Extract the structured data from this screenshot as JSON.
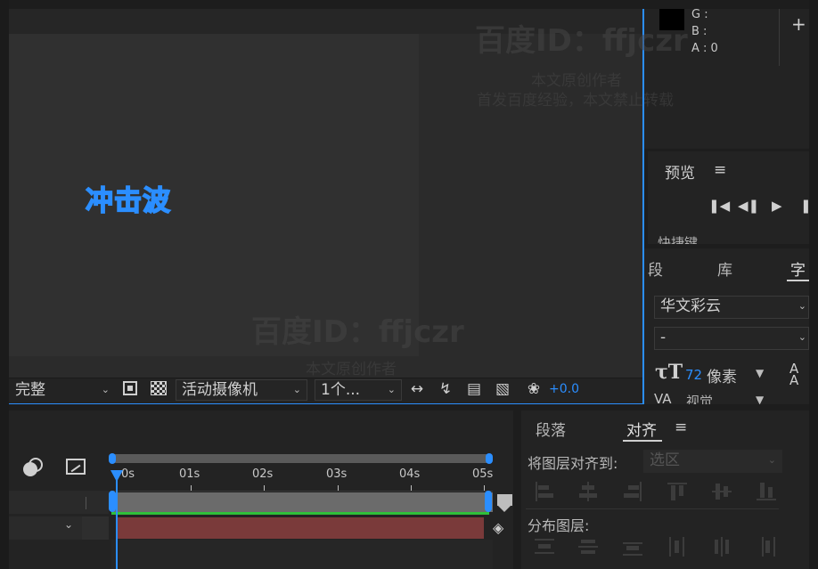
{
  "info": {
    "g_label": "G :",
    "b_label": "B :",
    "a_label": "A : 0",
    "add_symbol": "+"
  },
  "composition": {
    "title_text": "冲击波"
  },
  "viewer_toolbar": {
    "resolution": "完整",
    "camera": "活动摄像机",
    "views": "1个...",
    "exposure": "+0.0"
  },
  "preview_panel": {
    "title": "预览",
    "shortcut_label": "快捷键"
  },
  "character_panel": {
    "tabs": [
      "段",
      "库",
      "字"
    ],
    "font_family": "华文彩云",
    "font_style": "-",
    "font_size_value": "72",
    "font_size_unit": "像素",
    "tracking_label": "视觉"
  },
  "timeline": {
    "ruler_labels": [
      "0s",
      "01s",
      "02s",
      "03s",
      "04s",
      "05s"
    ]
  },
  "align_panel": {
    "tabs": [
      "段落",
      "对齐"
    ],
    "align_to_label": "将图层对齐到:",
    "align_to_value": "选区",
    "distribute_label": "分布图层:"
  },
  "watermark": {
    "line1": "百度ID：ffjczr",
    "line2": "本文原创作者",
    "line3": "首发百度经验，本文禁止转载"
  },
  "colors": {
    "accent_blue": "#2b8eff",
    "layer_bar": "#7a3a3a",
    "work_area": "#6b6b6b",
    "green": "#2fbf3a"
  }
}
